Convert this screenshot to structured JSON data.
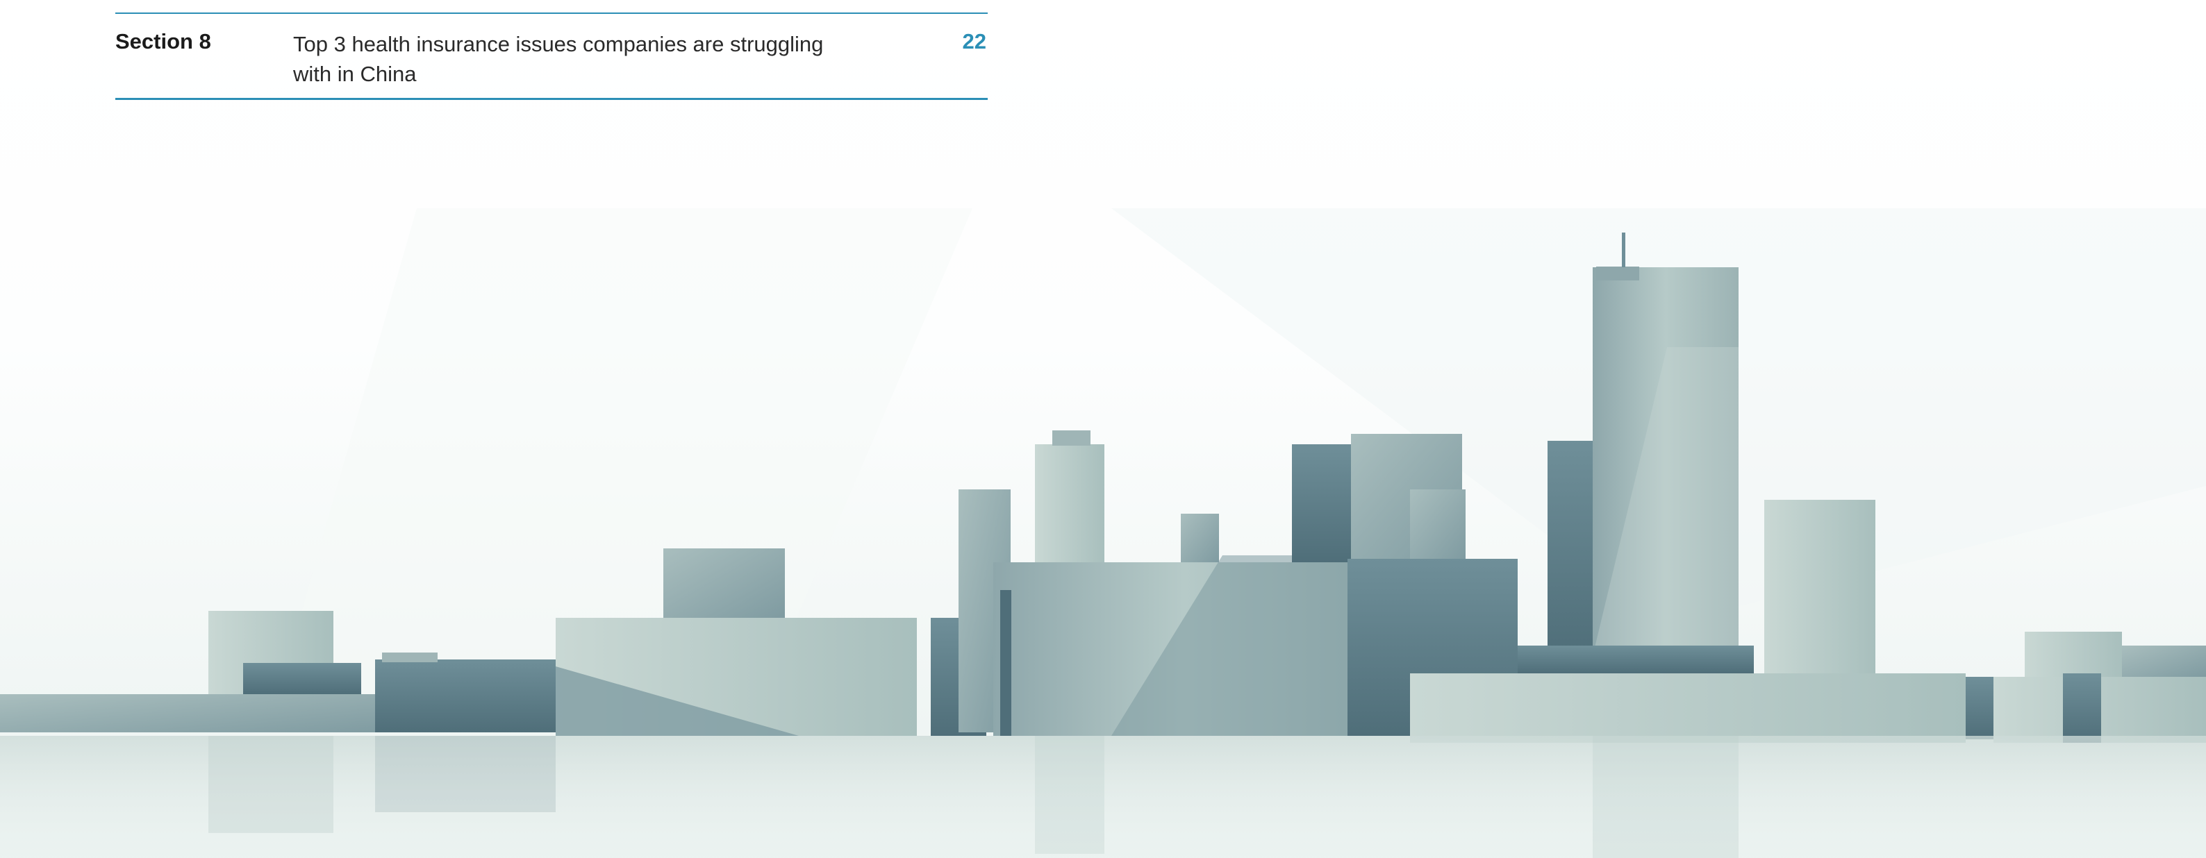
{
  "toc_entry": {
    "section_label": "Section 8",
    "title": "Top 3 health insurance issues companies are struggling with in China",
    "page_number": "22"
  },
  "colors": {
    "accent": "#2b8fb6",
    "building_dark": "#5f7f8a",
    "building_light": "#b9ccc9"
  }
}
